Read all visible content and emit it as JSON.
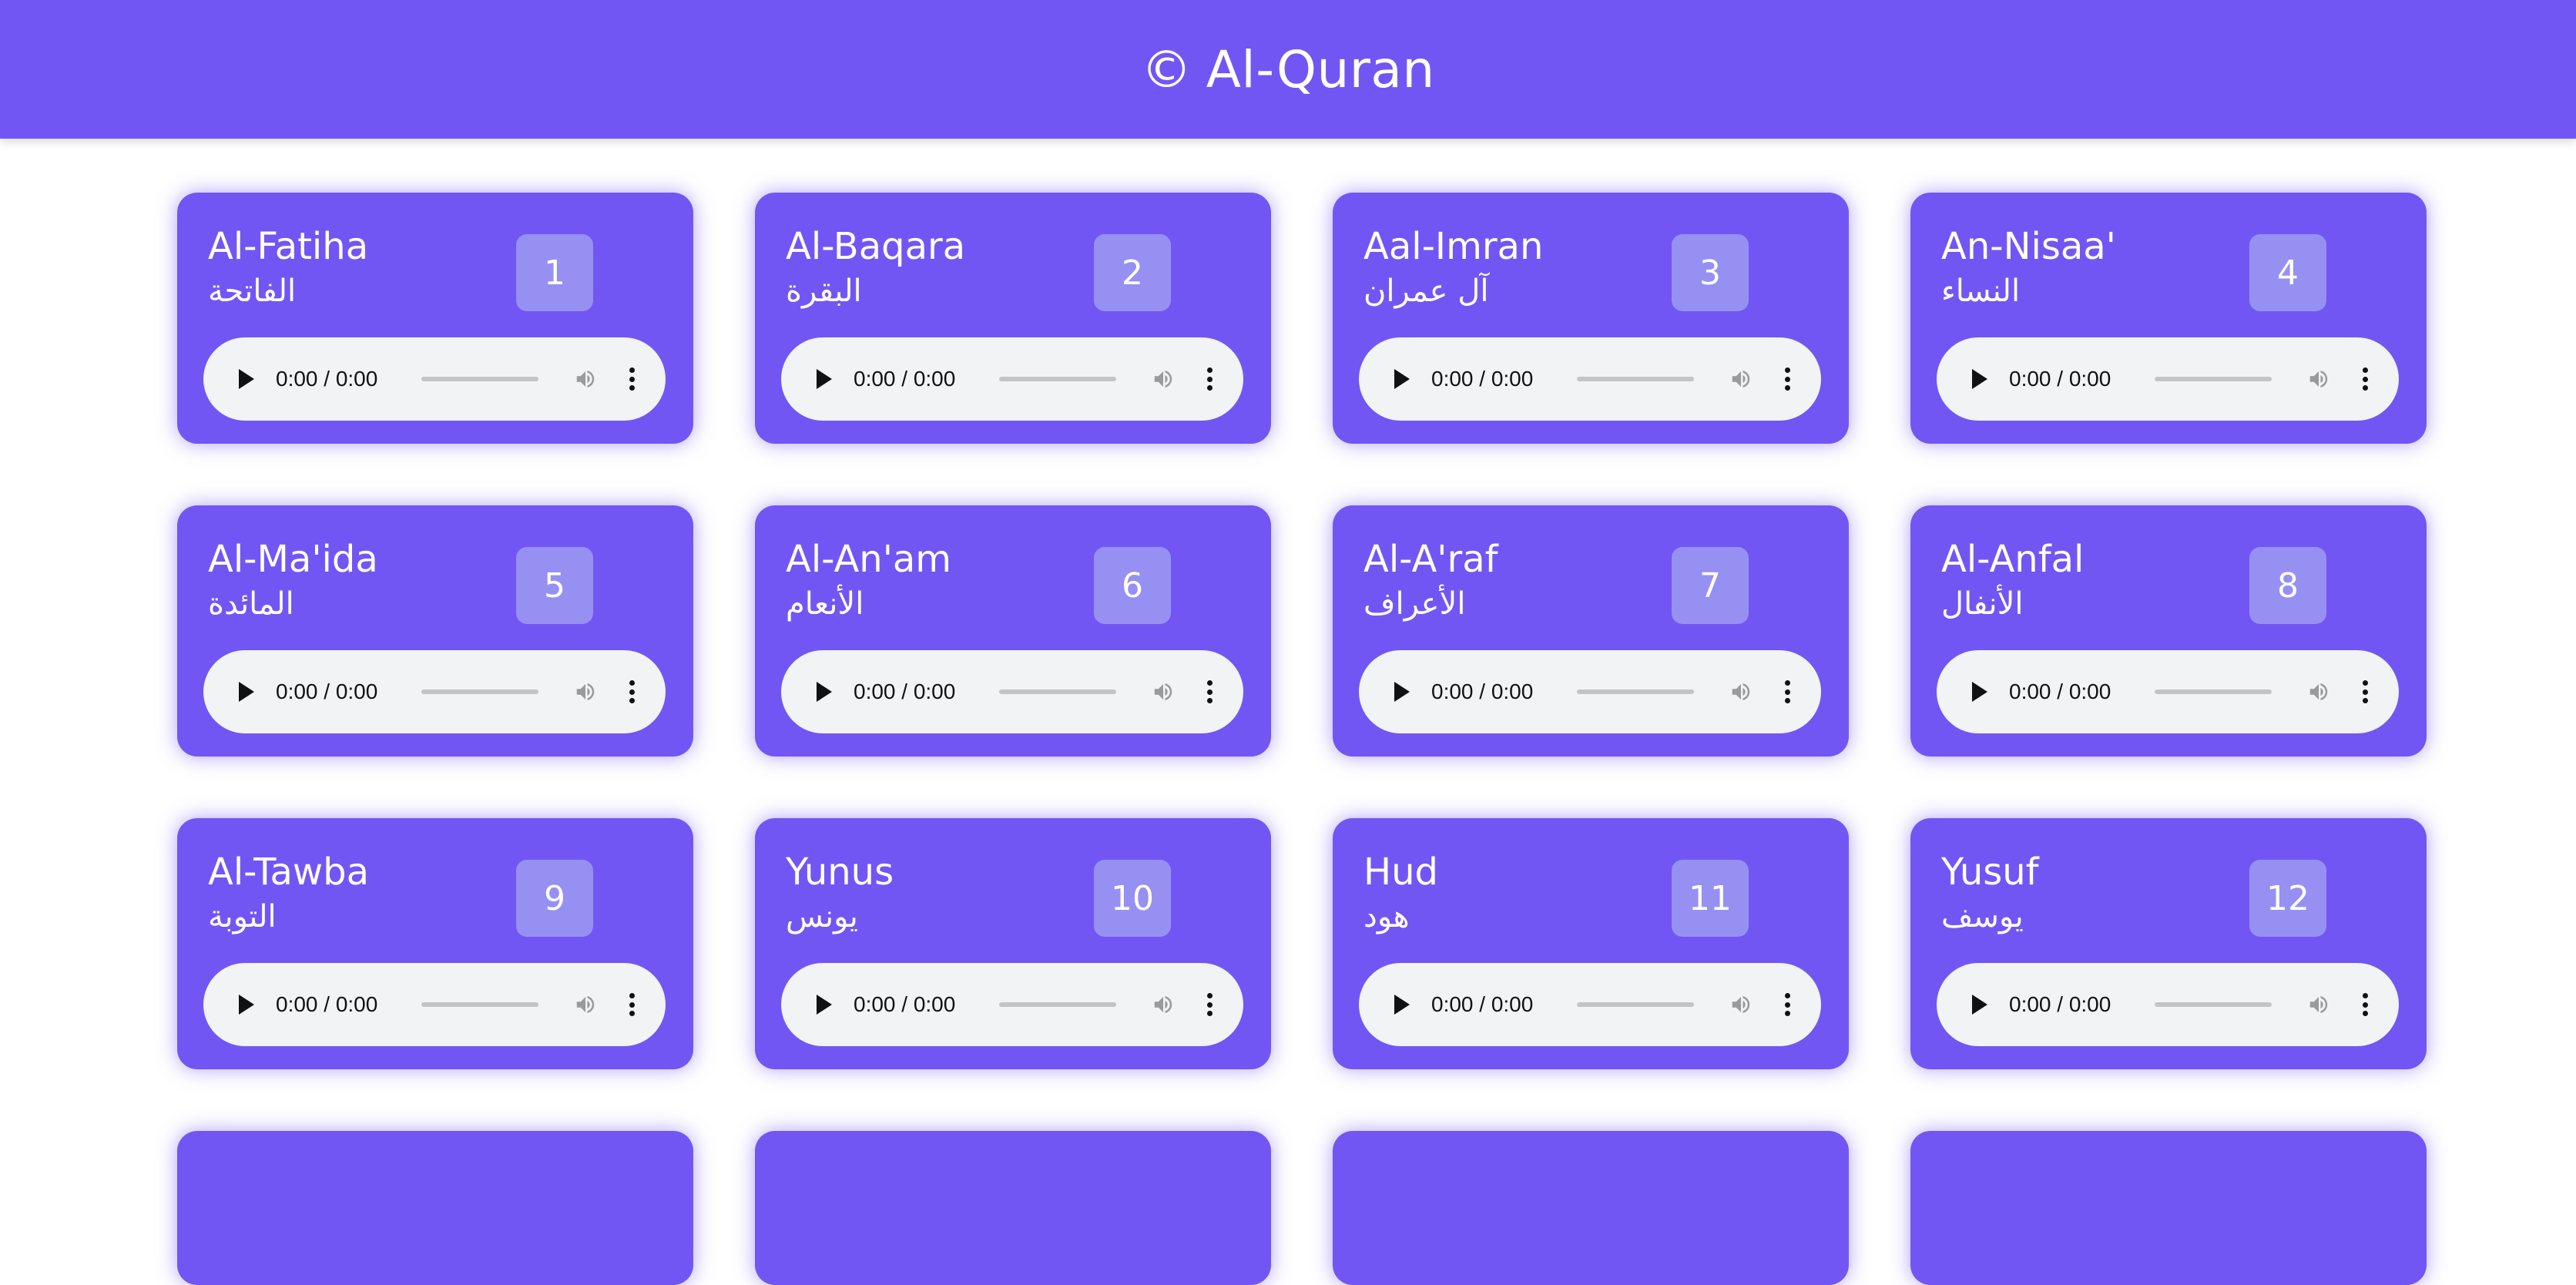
{
  "header": {
    "copyright_symbol": "©",
    "title": "Al-Quran"
  },
  "colors": {
    "primary": "#7256f4",
    "number_badge": "#9790f3",
    "player_bg": "#f1f3f4"
  },
  "player_time": "0:00 / 0:00",
  "surahs": [
    {
      "name": "Al-Fatiha",
      "arabic": "الفاتحة",
      "number": "1"
    },
    {
      "name": "Al-Baqara",
      "arabic": "البقرة",
      "number": "2"
    },
    {
      "name": "Aal-Imran",
      "arabic": "آل عمران",
      "number": "3"
    },
    {
      "name": "An-Nisaa'",
      "arabic": "النساء",
      "number": "4"
    },
    {
      "name": "Al-Ma'ida",
      "arabic": "المائدة",
      "number": "5"
    },
    {
      "name": "Al-An'am",
      "arabic": "الأنعام",
      "number": "6"
    },
    {
      "name": "Al-A'raf",
      "arabic": "الأعراف",
      "number": "7"
    },
    {
      "name": "Al-Anfal",
      "arabic": "الأنفال",
      "number": "8"
    },
    {
      "name": "Al-Tawba",
      "arabic": "التوبة",
      "number": "9"
    },
    {
      "name": "Yunus",
      "arabic": "يونس",
      "number": "10"
    },
    {
      "name": "Hud",
      "arabic": "هود",
      "number": "11"
    },
    {
      "name": "Yusuf",
      "arabic": "يوسف",
      "number": "12"
    }
  ]
}
